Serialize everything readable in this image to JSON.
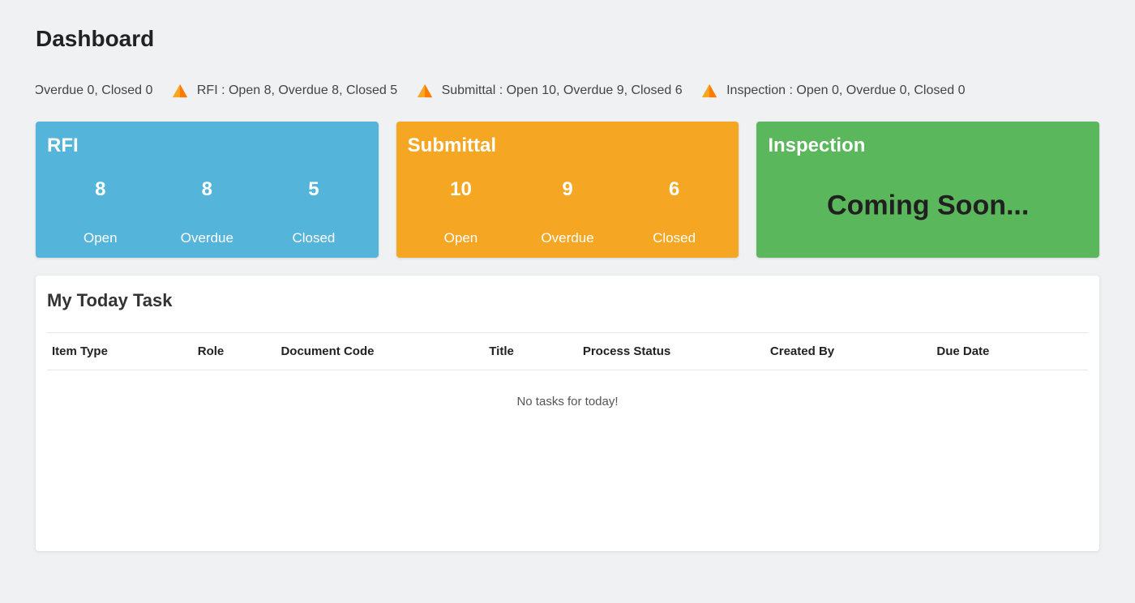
{
  "title": "Dashboard",
  "ticker": [
    {
      "label": "RFI",
      "text": "Open 8, Overdue 8, Closed 5"
    },
    {
      "label": "Submittal",
      "text": "Open 10, Overdue 9, Closed 6"
    },
    {
      "label": "Inspection",
      "text": "Open 0, Overdue 0, Closed 0"
    }
  ],
  "cards": {
    "rfi": {
      "title": "RFI",
      "open": {
        "value": "8",
        "label": "Open"
      },
      "overdue": {
        "value": "8",
        "label": "Overdue"
      },
      "closed": {
        "value": "5",
        "label": "Closed"
      }
    },
    "submittal": {
      "title": "Submittal",
      "open": {
        "value": "10",
        "label": "Open"
      },
      "overdue": {
        "value": "9",
        "label": "Overdue"
      },
      "closed": {
        "value": "6",
        "label": "Closed"
      }
    },
    "inspection": {
      "title": "Inspection",
      "coming_soon": "Coming Soon..."
    }
  },
  "tasks": {
    "panel_title": "My Today Task",
    "columns": {
      "item_type": "Item Type",
      "role": "Role",
      "document_code": "Document Code",
      "title": "Title",
      "process_status": "Process Status",
      "created_by": "Created By",
      "due_date": "Due Date"
    },
    "empty_message": "No tasks for today!"
  },
  "colors": {
    "card_blue": "#55b4da",
    "card_orange": "#f5a623",
    "card_green": "#5bb75b",
    "icon_orange": "#f5a623"
  }
}
